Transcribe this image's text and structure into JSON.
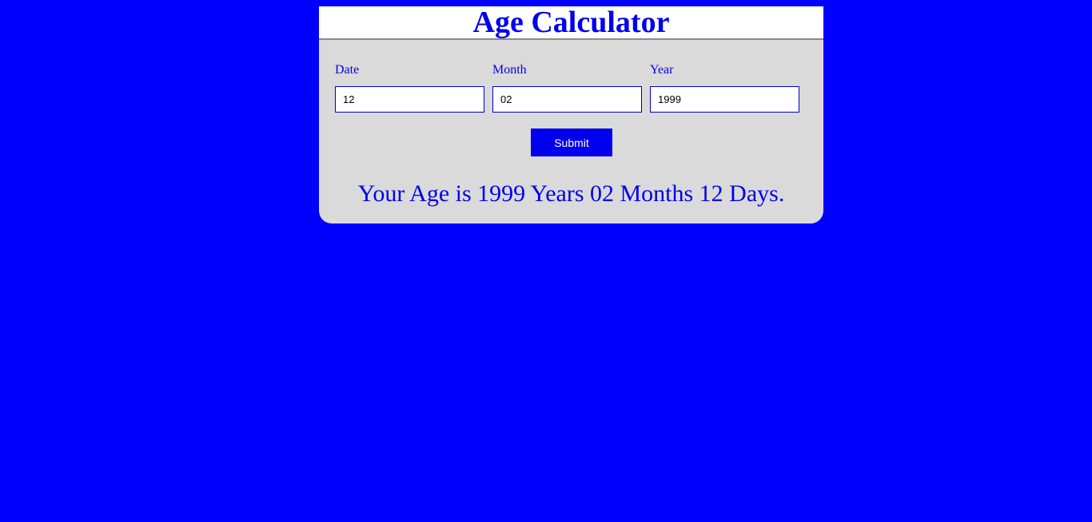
{
  "colors": {
    "background": "#0000ff",
    "accent": "#0000ee",
    "card": "#dadada"
  },
  "header": {
    "title": "Age Calculator"
  },
  "form": {
    "date": {
      "label": "Date",
      "value": "12"
    },
    "month": {
      "label": "Month",
      "value": "02"
    },
    "year": {
      "label": "Year",
      "value": "1999"
    },
    "submit_label": "Submit"
  },
  "result": {
    "text": "Your Age is 1999 Years 02 Months 12 Days."
  }
}
